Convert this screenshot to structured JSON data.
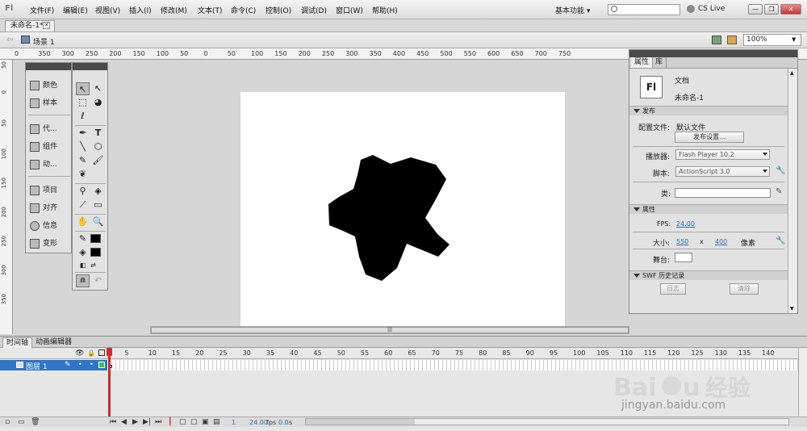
{
  "app": {
    "logo": "Fl"
  },
  "menus": [
    "文件(F)",
    "编辑(E)",
    "视图(V)",
    "插入(I)",
    "修改(M)",
    "文本(T)",
    "命令(C)",
    "控制(O)",
    "调试(D)",
    "窗口(W)",
    "帮助(H)"
  ],
  "workspace": "基本功能 ▾",
  "cs_live": "CS Live",
  "document": {
    "tab": "未命名-1*",
    "scene": "场景 1",
    "zoom": "100%"
  },
  "ruler": {
    "h_labels": [
      "0",
      "350",
      "300",
      "250",
      "200",
      "150",
      "100",
      "50",
      "0",
      "50",
      "100",
      "150",
      "200",
      "250",
      "300",
      "350",
      "400",
      "450",
      "500",
      "550",
      "600",
      "650",
      "700",
      "750"
    ],
    "v_labels": [
      "50",
      "0",
      "50",
      "100",
      "150",
      "200",
      "250",
      "300",
      "350"
    ]
  },
  "left_panel": {
    "items": [
      "颜色",
      "样本",
      "代...",
      "组件",
      "动...",
      "项目",
      "对齐",
      "信息",
      "变形"
    ]
  },
  "properties": {
    "tabs": [
      "属性",
      "库"
    ],
    "doc_type": "文档",
    "doc_name": "未命名-1",
    "sections": {
      "publish": "发布",
      "attributes": "属性",
      "swf_history": "SWF 历史记录"
    },
    "profile_label": "配置文件:",
    "profile_value": "默认文件",
    "publish_settings_button": "发布设置...",
    "player_label": "播放器:",
    "player_value": "Flash Player 10.2",
    "script_label": "脚本:",
    "script_value": "ActionScript 3.0",
    "class_label": "类:",
    "fps_label": "FPS:",
    "fps_value": "24.00",
    "size_label": "大小:",
    "width": "550",
    "times": "x",
    "height": "400",
    "unit": "像素",
    "stage_label": "舞台:",
    "log_button": "日志",
    "clear_button": "清除"
  },
  "timeline": {
    "tabs": [
      "时间轴",
      "动画编辑器"
    ],
    "frame_numbers": [
      "1",
      "5",
      "10",
      "15",
      "20",
      "25",
      "30",
      "35",
      "40",
      "45",
      "50",
      "55",
      "60",
      "65",
      "70",
      "75",
      "80",
      "85",
      "90",
      "95",
      "100",
      "105",
      "110",
      "115",
      "120",
      "125",
      "130",
      "135",
      "140"
    ],
    "layer_name": "图层 1",
    "current_frame": "1",
    "fps": "24.00",
    "fps_unit": "fps",
    "time": "0.0",
    "time_unit": "s"
  },
  "watermark": {
    "brand": "Baidu 经验",
    "url": "jingyan.baidu.com"
  },
  "colors": {
    "selection": "#2f74c6",
    "playhead": "#d42828",
    "stage": "#ffffff",
    "shape": "#000000"
  }
}
